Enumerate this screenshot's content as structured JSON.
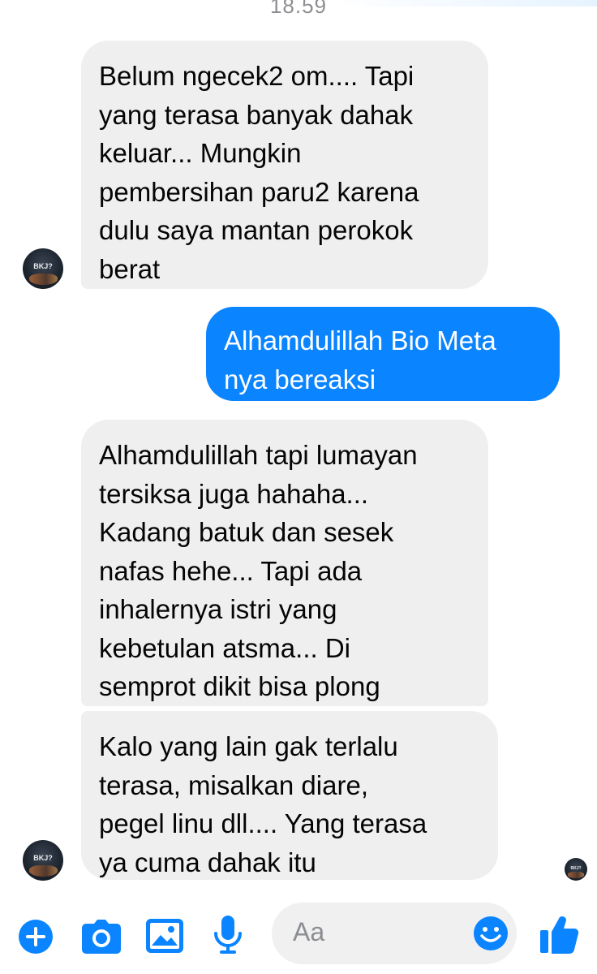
{
  "header": {
    "timestamp": "18.59"
  },
  "messages": [
    {
      "direction": "in",
      "lines": [
        "Belum ngecek2 om.... Tapi",
        "yang terasa banyak dahak",
        "keluar... Mungkin",
        "pembersihan paru2 karena",
        "dulu saya mantan perokok",
        "berat"
      ]
    },
    {
      "direction": "out",
      "lines": [
        "Alhamdulillah Bio Meta",
        "nya bereaksi"
      ]
    },
    {
      "direction": "in",
      "lines": [
        "Alhamdulillah tapi lumayan",
        "tersiksa juga hahaha...",
        "Kadang batuk dan sesek",
        "nafas hehe... Tapi ada",
        "inhalernya istri yang",
        "kebetulan atsma... Di",
        "semprot dikit bisa plong"
      ]
    },
    {
      "direction": "in",
      "lines": [
        "Kalo yang lain gak terlalu",
        "terasa, misalkan diare,",
        "pegel linu dll....  Yang terasa",
        "ya cuma dahak itu"
      ]
    }
  ],
  "avatar": {
    "label": "BKJ?"
  },
  "composer": {
    "placeholder": "Aa",
    "icons": [
      "plus-icon",
      "camera-icon",
      "gallery-icon",
      "microphone-icon",
      "emoji-icon",
      "thumbs-up-icon"
    ]
  },
  "colors": {
    "accent": "#0a84ff",
    "incoming_bubble": "#efefef",
    "outgoing_text": "#ffffff"
  }
}
